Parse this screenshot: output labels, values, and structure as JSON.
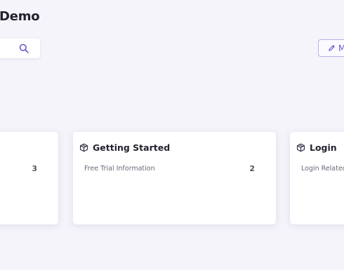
{
  "page": {
    "title": "Demo"
  },
  "search": {
    "icon": "search-icon"
  },
  "toolbar": {
    "manage_label": "M",
    "manage_icon": "pencil-icon"
  },
  "categories": [
    {
      "name": "",
      "description": "",
      "count": "3",
      "icon": "cube-icon"
    },
    {
      "name": "Getting Started",
      "description": "Free Trial Information",
      "count": "2",
      "icon": "cube-icon"
    },
    {
      "name": "Login",
      "description": "Login Related",
      "count": "",
      "icon": "cube-icon"
    }
  ],
  "colors": {
    "accent": "#6c58c9",
    "background": "#f5f4fa",
    "card": "#ffffff"
  }
}
